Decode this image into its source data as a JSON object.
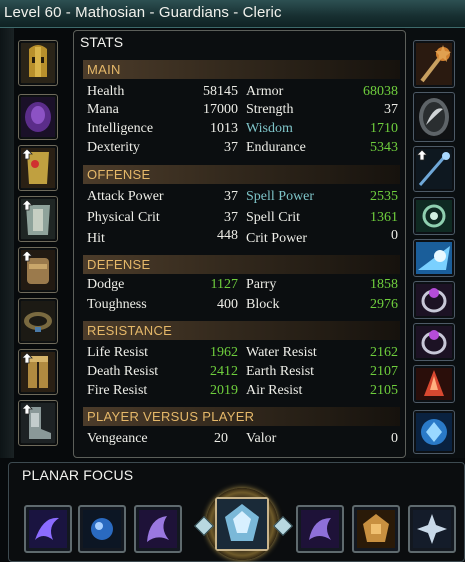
{
  "window": {
    "title": "Level 60 - Mathosian - Guardians - Cleric"
  },
  "stats": {
    "title": "STATS",
    "sections": {
      "main": "MAIN",
      "offense": "OFFENSE",
      "defense": "DEFENSE",
      "resistance": "RESISTANCE",
      "pvp": "PLAYER VERSUS PLAYER"
    },
    "main": {
      "health": {
        "label": "Health",
        "value": "58145"
      },
      "armor": {
        "label": "Armor",
        "value": "68038"
      },
      "mana": {
        "label": "Mana",
        "value": "17000"
      },
      "strength": {
        "label": "Strength",
        "value": "37"
      },
      "intelligence": {
        "label": "Intelligence",
        "value": "1013"
      },
      "wisdom": {
        "label": "Wisdom",
        "value": "1710"
      },
      "dexterity": {
        "label": "Dexterity",
        "value": "37"
      },
      "endurance": {
        "label": "Endurance",
        "value": "5343"
      }
    },
    "offense": {
      "attack_power": {
        "label": "Attack Power",
        "value": "37"
      },
      "spell_power": {
        "label": "Spell Power",
        "value": "2535"
      },
      "physical_crit": {
        "label": "Physical Crit",
        "value": "37"
      },
      "spell_crit": {
        "label": "Spell Crit",
        "value": "1361"
      },
      "hit": {
        "label": "Hit",
        "value": "448"
      },
      "crit_power": {
        "label": "Crit Power",
        "value": "0"
      }
    },
    "defense": {
      "dodge": {
        "label": "Dodge",
        "value": "1127"
      },
      "parry": {
        "label": "Parry",
        "value": "1858"
      },
      "toughness": {
        "label": "Toughness",
        "value": "400"
      },
      "block": {
        "label": "Block",
        "value": "2976"
      }
    },
    "resistance": {
      "life": {
        "label": "Life Resist",
        "value": "1962"
      },
      "water": {
        "label": "Water Resist",
        "value": "2162"
      },
      "death": {
        "label": "Death Resist",
        "value": "2412"
      },
      "earth": {
        "label": "Earth Resist",
        "value": "2107"
      },
      "fire": {
        "label": "Fire Resist",
        "value": "2019"
      },
      "air": {
        "label": "Air Resist",
        "value": "2105"
      }
    },
    "pvp": {
      "vengeance": {
        "label": "Vengeance",
        "value": "20"
      },
      "valor": {
        "label": "Valor",
        "value": "0"
      }
    }
  },
  "planar_focus": {
    "title": "PLANAR FOCUS"
  },
  "colors": {
    "label": "#eeeee8",
    "buffed": "#6fcf3d",
    "highlight": "#7ec4c8",
    "section_header": "#e5b869"
  },
  "equipment_left": [
    {
      "icon": "helmet-icon",
      "upgrade": false
    },
    {
      "icon": "shoulders-icon",
      "upgrade": false
    },
    {
      "icon": "cloak-icon",
      "upgrade": true
    },
    {
      "icon": "chest-armor-icon",
      "upgrade": true
    },
    {
      "icon": "gloves-icon",
      "upgrade": true
    },
    {
      "icon": "belt-icon",
      "upgrade": false
    },
    {
      "icon": "legs-armor-icon",
      "upgrade": true
    },
    {
      "icon": "boots-icon",
      "upgrade": true
    }
  ],
  "equipment_right": [
    {
      "icon": "mace-icon"
    },
    {
      "icon": "shield-icon"
    },
    {
      "icon": "wand-icon",
      "upgrade": true
    },
    {
      "icon": "neck-icon"
    },
    {
      "icon": "trinket-icon"
    },
    {
      "icon": "ring-icon"
    },
    {
      "icon": "ring-icon"
    },
    {
      "icon": "synergy-crystal-icon"
    },
    {
      "icon": "seal-icon"
    }
  ],
  "planar_slots": [
    {
      "icon": "lesser-essence-icon"
    },
    {
      "icon": "lesser-essence-icon"
    },
    {
      "icon": "greater-essence-icon"
    },
    {
      "icon": "planar-focus-icon"
    },
    {
      "icon": "greater-essence-icon"
    },
    {
      "icon": "lesser-essence-icon"
    },
    {
      "icon": "lesser-essence-icon"
    }
  ]
}
